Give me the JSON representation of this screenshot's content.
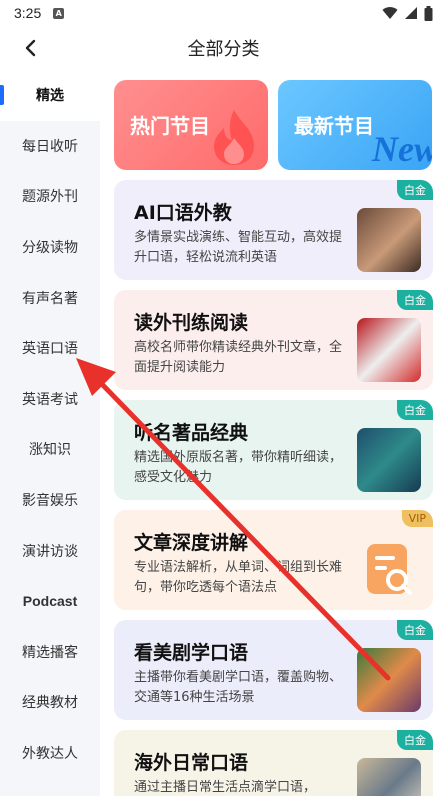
{
  "status": {
    "time": "3:25",
    "a_icon": "A"
  },
  "header": {
    "title": "全部分类"
  },
  "sidebar": {
    "items": [
      {
        "label": "精选",
        "active": true
      },
      {
        "label": "每日收听"
      },
      {
        "label": "题源外刊"
      },
      {
        "label": "分级读物"
      },
      {
        "label": "有声名著"
      },
      {
        "label": "英语口语"
      },
      {
        "label": "英语考试"
      },
      {
        "label": "涨知识"
      },
      {
        "label": "影音娱乐"
      },
      {
        "label": "演讲访谈"
      },
      {
        "label": "Podcast"
      },
      {
        "label": "精选播客"
      },
      {
        "label": "经典教材"
      },
      {
        "label": "外教达人"
      }
    ]
  },
  "tiles": {
    "hot": "热门节目",
    "new": "最新节目",
    "new_word": "New"
  },
  "cards": [
    {
      "title": "AI口语外教",
      "desc": "多情景实战演练、智能互动，高效提升口语，轻松说流利英语",
      "badge": "白金"
    },
    {
      "title": "读外刊练阅读",
      "desc": "高校名师带你精读经典外刊文章，全面提升阅读能力",
      "badge": "白金"
    },
    {
      "title": "听名著品经典",
      "desc": "精选国外原版名著，带你精听细读，感受文化魅力",
      "badge": "白金"
    },
    {
      "title": "文章深度讲解",
      "desc": "专业语法解析，从单词、词组到长难句，带你吃透每个语法点",
      "badge": "VIP"
    },
    {
      "title": "看美剧学口语",
      "desc": "主播带你看美剧学口语，覆盖购物、交通等16种生活场景",
      "badge": "白金"
    },
    {
      "title": "海外日常口语",
      "desc": "通过主播日常生活点滴学口语，",
      "badge": "白金"
    }
  ],
  "colors": {
    "accent": "#1e6cff",
    "arrow": "#e8312b"
  },
  "icons": [
    "back-arrow-icon",
    "wifi-icon",
    "signal-icon",
    "battery-icon",
    "flame-icon",
    "document-search-icon"
  ]
}
